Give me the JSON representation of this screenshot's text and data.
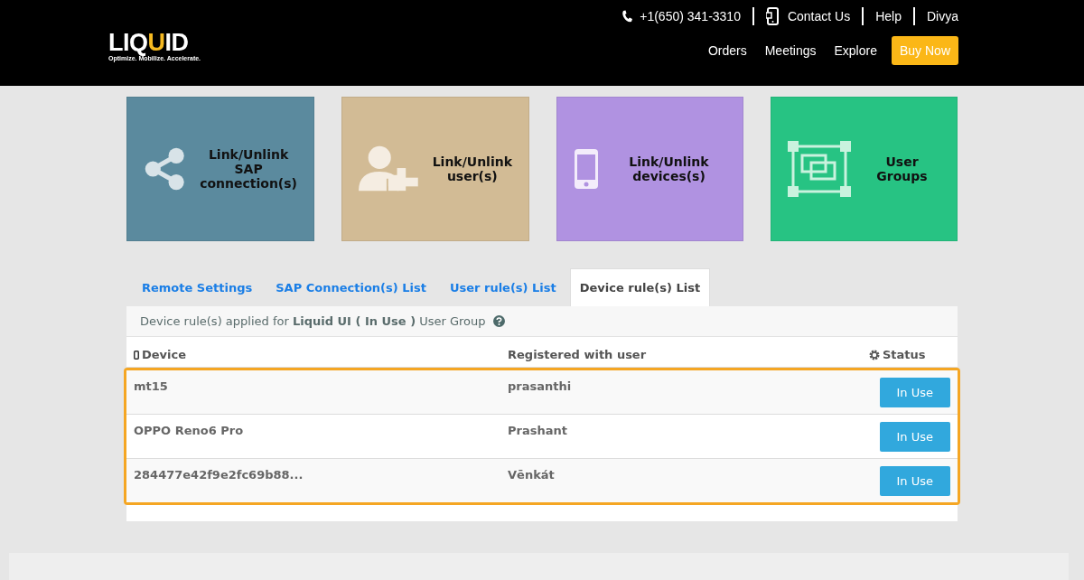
{
  "header": {
    "logo": {
      "text_a": "LIQ",
      "text_b": "U",
      "text_c": "ID",
      "tagline": "Optimize. Mobilize. Accelerate."
    },
    "phone": "+1(650) 341-3310",
    "top_links": [
      "Contact Us",
      "Help",
      "Divya"
    ],
    "nav": [
      "Orders",
      "Meetings",
      "Explore"
    ],
    "cta": "Buy Now"
  },
  "tiles": [
    {
      "kind": "share",
      "label": "Link/Unlink SAP connection(s)",
      "color": "#5b8a9e"
    },
    {
      "kind": "user-add",
      "label": "Link/Unlink user(s)",
      "color": "#d2bb95"
    },
    {
      "kind": "phone",
      "label": "Link/Unlink devices(s)",
      "color": "#b092e1"
    },
    {
      "kind": "group",
      "label": "User Groups",
      "color": "#27c383"
    }
  ],
  "tabs": [
    {
      "label": "Remote Settings",
      "selected": false
    },
    {
      "label": "SAP Connection(s) List",
      "selected": false
    },
    {
      "label": "User rule(s) List",
      "selected": false
    },
    {
      "label": "Device rule(s) List",
      "selected": true
    }
  ],
  "info": "Device rule(s) applied for **Liquid UI ( In Use )** User Group",
  "table": {
    "columns": [
      "Device",
      "Registered with user",
      "Status"
    ],
    "rows": [
      {
        "device": "mt15",
        "user": "prasanthi",
        "status": "In Use"
      },
      {
        "device": "OPPO Reno6 Pro",
        "user": "Prashant",
        "status": "In Use"
      },
      {
        "device": "284477e42f9e2fc69b88...",
        "user": "Vēnkát",
        "status": "In Use"
      }
    ]
  }
}
